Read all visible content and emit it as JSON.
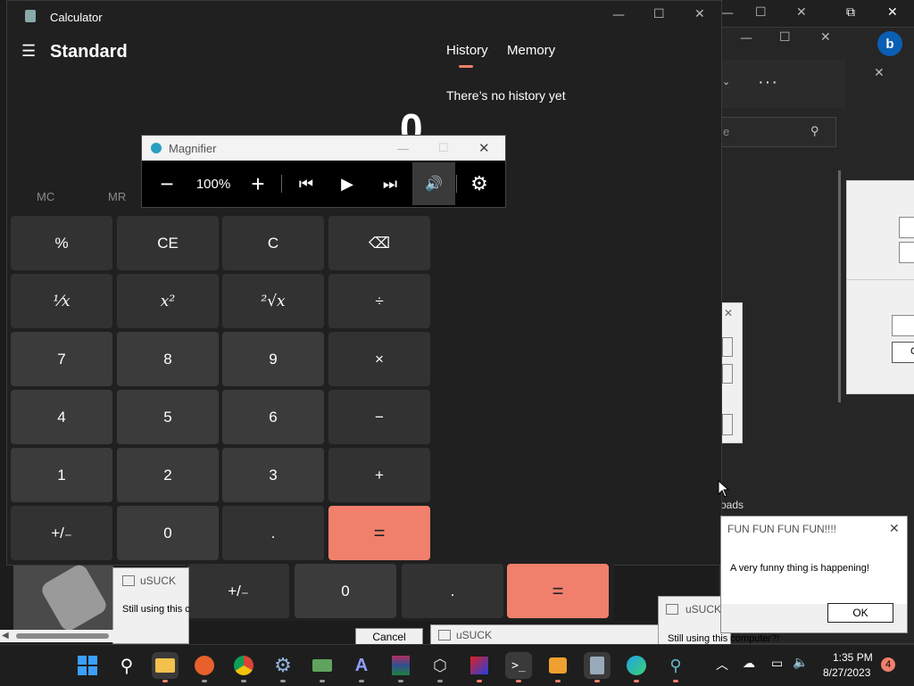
{
  "calculator": {
    "title": "Calculator",
    "mode": "Standard",
    "display": "0",
    "panel_tabs": [
      "History",
      "Memory"
    ],
    "active_tab": "History",
    "history_empty": "There’s no history yet",
    "memory_buttons": [
      "MC",
      "MR"
    ],
    "keys": [
      [
        "%",
        "CE",
        "C",
        "⌫"
      ],
      [
        "¹⁄x",
        "x²",
        "²√x",
        "÷"
      ],
      [
        "7",
        "8",
        "9",
        "×"
      ],
      [
        "4",
        "5",
        "6",
        "−"
      ],
      [
        "1",
        "2",
        "3",
        "+"
      ],
      [
        "+/₋",
        "0",
        ".",
        "="
      ]
    ]
  },
  "ghost_calc_keys": [
    "+/₋",
    "0",
    ".",
    "="
  ],
  "magnifier": {
    "title": "Magnifier",
    "zoom": "100%"
  },
  "fun_dialog": {
    "title": "FUN FUN FUN FUN!!!!",
    "message": "A very funny thing is happening!",
    "ok": "OK"
  },
  "usuck_windows": [
    {
      "title": "uSUCK",
      "text": "Still using this c"
    },
    {
      "title": "uSUCK",
      "text": ""
    },
    {
      "title": "uSUCK",
      "text": "Still using this computer?!"
    }
  ],
  "background_text": {
    "downloads_fragment": "oads",
    "search_placeholder": "e",
    "cancel_button": "Cancel",
    "partial_button": "C"
  },
  "taskbar": {
    "time": "1:35 PM",
    "date": "8/27/2023",
    "notification_count": "4"
  },
  "colors": {
    "accent": "#f0806c",
    "calc_bg": "#202020",
    "key_bg": "#3b3b3b"
  }
}
